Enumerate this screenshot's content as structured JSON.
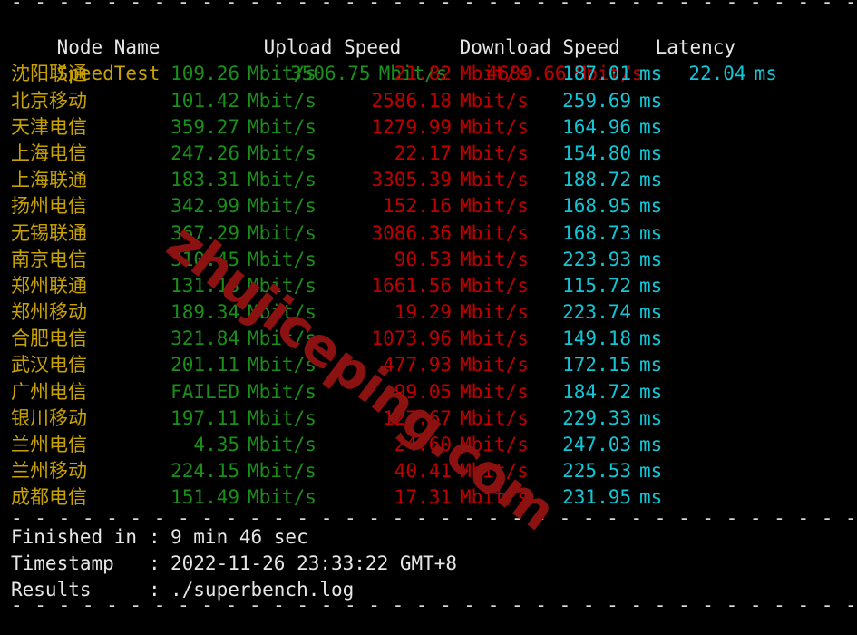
{
  "terminal": {
    "separator_top": "- - - - - - - - - - - - - - - - - - - - - - - - - - - - - - - - - - - - - - - - - - - - - - - -",
    "separator_mid": "- - - - - - - - - - - - - - - - - - - - - - - - - - - - - - - - - - - - - - - - - - - - - - - -",
    "separator_bottom": "- - - - - - - - - - - - - - - - - - - - - - - - - - - - - - - - - - - - - - - - - - - - - - - -",
    "watermark": "zhujiceping.com",
    "colors": {
      "background": "#000000",
      "header": "#e6e6e6",
      "node_name": "#c8a200",
      "upload": "#1a8f1a",
      "download": "#c00000",
      "latency": "#10c7d8",
      "separator": "#d8d8d8",
      "watermark": "#8c1111"
    }
  },
  "table": {
    "headers": {
      "node": "Node Name",
      "upload": "Upload Speed",
      "download": "Download Speed",
      "latency": "Latency"
    },
    "units": {
      "speed": "Mbit/s",
      "latency": "ms"
    },
    "summary_row": {
      "node": "SpeedTest",
      "upload": "3506.75",
      "download": "4689.66",
      "latency": "22.04"
    },
    "rows": [
      {
        "node": "沈阳联通",
        "upload": "109.26",
        "download": "21.82",
        "latency": "187.01"
      },
      {
        "node": "北京移动",
        "upload": "101.42",
        "download": "2586.18",
        "latency": "259.69"
      },
      {
        "node": "天津电信",
        "upload": "359.27",
        "download": "1279.99",
        "latency": "164.96"
      },
      {
        "node": "上海电信",
        "upload": "247.26",
        "download": "22.17",
        "latency": "154.80"
      },
      {
        "node": "上海联通",
        "upload": "183.31",
        "download": "3305.39",
        "latency": "188.72"
      },
      {
        "node": "扬州电信",
        "upload": "342.99",
        "download": "152.16",
        "latency": "168.95"
      },
      {
        "node": "无锡联通",
        "upload": "367.29",
        "download": "3086.36",
        "latency": "168.73"
      },
      {
        "node": "南京电信",
        "upload": "310.45",
        "download": "90.53",
        "latency": "223.93"
      },
      {
        "node": "郑州联通",
        "upload": "131.18",
        "download": "1661.56",
        "latency": "115.72"
      },
      {
        "node": "郑州移动",
        "upload": "189.34",
        "download": "19.29",
        "latency": "223.74"
      },
      {
        "node": "合肥电信",
        "upload": "321.84",
        "download": "1073.96",
        "latency": "149.18"
      },
      {
        "node": "武汉电信",
        "upload": "201.11",
        "download": "477.93",
        "latency": "172.15"
      },
      {
        "node": "广州电信",
        "upload": "FAILED",
        "download": "99.05",
        "latency": "184.72"
      },
      {
        "node": "银川移动",
        "upload": "197.11",
        "download": "127.67",
        "latency": "229.33"
      },
      {
        "node": "兰州电信",
        "upload": "4.35",
        "download": "24.60",
        "latency": "247.03"
      },
      {
        "node": "兰州移动",
        "upload": "224.15",
        "download": "40.41",
        "latency": "225.53"
      },
      {
        "node": "成都电信",
        "upload": "151.49",
        "download": "17.31",
        "latency": "231.95"
      }
    ]
  },
  "footer": {
    "items": [
      {
        "label": "Finished in",
        "colon": ":",
        "value": "9 min 46 sec"
      },
      {
        "label": "Timestamp",
        "colon": ":",
        "value": "2022-11-26 23:33:22 GMT+8"
      },
      {
        "label": "Results",
        "colon": ":",
        "value": "./superbench.log"
      }
    ]
  }
}
